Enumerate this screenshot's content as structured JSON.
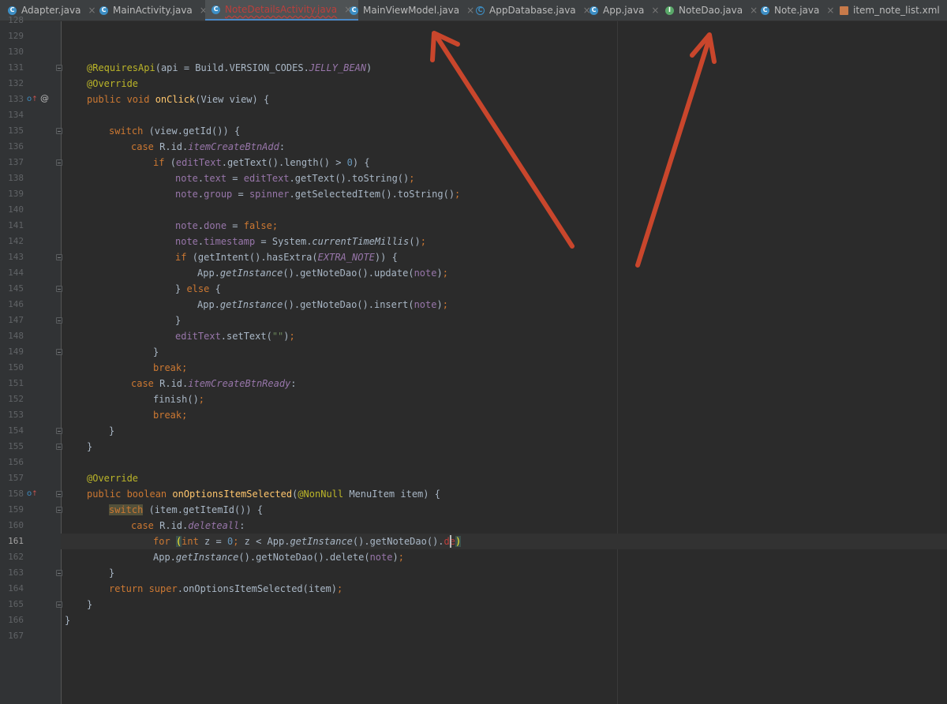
{
  "tabs": [
    {
      "name": "Adapter.java",
      "icon": "C"
    },
    {
      "name": "MainActivity.java",
      "icon": "C"
    },
    {
      "name": "NoteDetailsActivity.java",
      "icon": "C"
    },
    {
      "name": "MainViewModel.java",
      "icon": "C"
    },
    {
      "name": "AppDatabase.java",
      "icon": "C"
    },
    {
      "name": "App.java",
      "icon": "C"
    },
    {
      "name": "NoteDao.java",
      "icon": "I"
    },
    {
      "name": "Note.java",
      "icon": "C"
    },
    {
      "name": "item_note_list.xml",
      "icon": ""
    }
  ],
  "tab_close": "×",
  "line_numbers": [
    "128",
    "129",
    "130",
    "131",
    "132",
    "133",
    "134",
    "135",
    "136",
    "137",
    "138",
    "139",
    "140",
    "141",
    "142",
    "143",
    "144",
    "145",
    "146",
    "147",
    "148",
    "149",
    "150",
    "151",
    "152",
    "153",
    "154",
    "155",
    "156",
    "157",
    "158",
    "159",
    "160",
    "161",
    "162",
    "163",
    "164",
    "165",
    "166",
    "167"
  ],
  "gutter": {
    "override_icon": "o",
    "up_arrow": "↑",
    "at_symbol": "@"
  },
  "code": {
    "l131": {
      "a1": "@RequiresApi",
      "p1": "(",
      "p2": "api = Build.",
      "f1": "VERSION_CODES",
      "p3": ".",
      "c1": "JELLY_BEAN",
      "p4": ")"
    },
    "l132": {
      "a1": "@Override"
    },
    "l133": {
      "k1": "public void ",
      "f1": "onClick",
      "p1": "(View view) {"
    },
    "l135": {
      "k1": "switch ",
      "p1": "(view.getId()) {"
    },
    "l136": {
      "k1": "case ",
      "p1": "R.id.",
      "c1": "itemCreateBtnAdd",
      "p2": ":"
    },
    "l137": {
      "k1": "if ",
      "p1": "(",
      "f1": "editText",
      "p2": ".getText().length() > ",
      "n1": "0",
      "p3": ") {"
    },
    "l138": {
      "f1": "note",
      "p1": ".",
      "f2": "text",
      "p2": " = ",
      "f3": "editText",
      "p3": ".getText().toString()",
      ";": ";"
    },
    "l139": {
      "f1": "note",
      "p1": ".",
      "f2": "group",
      "p2": " = ",
      "f3": "spinner",
      "p3": ".getSelectedItem().toString()",
      ";": ";"
    },
    "l141": {
      "f1": "note",
      "p1": ".",
      "f2": "done",
      "p2": " = ",
      "k1": "false",
      ";": ";"
    },
    "l142": {
      "f1": "note",
      "p1": ".",
      "f2": "timestamp",
      "p2": " = System.",
      "c1": "currentTimeMillis",
      "p3": "()",
      ";": ";"
    },
    "l143": {
      "k1": "if ",
      "p1": "(getIntent().hasExtra(",
      "c1": "EXTRA_NOTE",
      "p2": ")) {"
    },
    "l144": {
      "p1": "App.",
      "c1": "getInstance",
      "p2": "().getNoteDao().update(",
      "f1": "note",
      "p3": ")",
      ";": ";"
    },
    "l145": {
      "p1": "} ",
      "k1": "else ",
      "p2": "{"
    },
    "l146": {
      "p1": "App.",
      "c1": "getInstance",
      "p2": "().getNoteDao().insert(",
      "f1": "note",
      "p3": ")",
      ";": ";"
    },
    "l147": {
      "p1": "}"
    },
    "l148": {
      "f1": "editText",
      "p1": ".setText(",
      "s1": "\"\"",
      "p2": ")",
      ";": ";"
    },
    "l149": {
      "p1": "}"
    },
    "l150": {
      "k1": "break;"
    },
    "l151": {
      "k1": "case ",
      "p1": "R.id.",
      "c1": "itemCreateBtnReady",
      "p2": ":"
    },
    "l152": {
      "p1": "finish()",
      ";": ";"
    },
    "l153": {
      "k1": "break;"
    },
    "l154": {
      "p1": "}"
    },
    "l155": {
      "p1": "}"
    },
    "l157": {
      "a1": "@Override"
    },
    "l158": {
      "k1": "public boolean ",
      "f1": "onOptionsItemSelected",
      "p1": "(",
      "a1": "@NonNull ",
      "p2": "MenuItem item) {"
    },
    "l159": {
      "k1": "switch",
      "p1": " (item.getItemId()) {"
    },
    "l160": {
      "k1": "case ",
      "p1": "R.id.",
      "c1": "deleteall",
      "p2": ":"
    },
    "l161": {
      "k1": "for ",
      "b1": "(",
      "k2": "int ",
      "p1": "z = ",
      "n1": "0",
      "k3": "; ",
      "p2": "z < App.",
      "c1": "getInstance",
      "p3": "().getNoteDao().",
      "e1": "de",
      "b2": ")"
    },
    "l162": {
      "p1": "App.",
      "c1": "getInstance",
      "p2": "().getNoteDao().delete(",
      "f1": "note",
      "p3": ")",
      ";": ";"
    },
    "l163": {
      "p1": "}"
    },
    "l164": {
      "k1": "return super",
      "p1": ".onOptionsItemSelected(item)",
      ";": ";"
    },
    "l165": {
      "p1": "}"
    },
    "l166": {
      "p1": "}"
    }
  },
  "colors": {
    "background": "#2b2b2b",
    "gutter": "#313335",
    "keyword": "#cc7832",
    "annotation": "#bbb529",
    "method": "#ffc66d",
    "field": "#9876aa",
    "number": "#6897bb",
    "string": "#6a8759",
    "plain": "#a9b7c6",
    "arrow": "#c9462c"
  }
}
